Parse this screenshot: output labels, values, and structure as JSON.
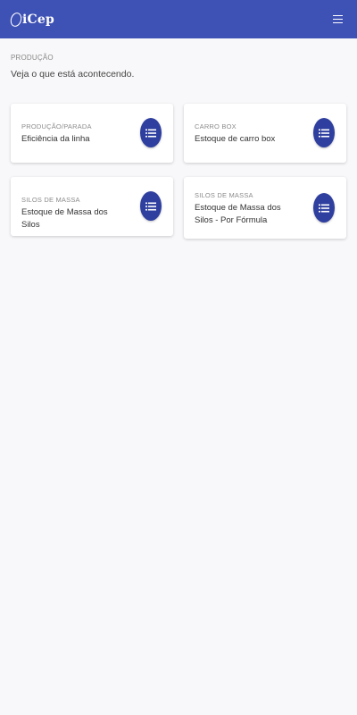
{
  "header": {
    "logo_text": "iCep",
    "menu_icon": "hamburger-menu-icon"
  },
  "main": {
    "section_label": "PRODUÇÃO",
    "subtitle": "Veja o que está acontecendo."
  },
  "cards": [
    {
      "kicker": "PRODUÇÃO/PARADA",
      "title": "Eficiência da linha",
      "icon": "list-icon"
    },
    {
      "kicker": "CARRO BOX",
      "title": "Estoque de carro box",
      "icon": "list-icon"
    },
    {
      "kicker": "SILOS DE MASSA",
      "title": "Estoque de Massa dos Silos",
      "icon": "list-icon"
    },
    {
      "kicker": "SILOS DE MASSA",
      "title": "Estoque de Massa dos Silos - Por Fórmula",
      "icon": "list-icon"
    }
  ],
  "colors": {
    "header_bg": "#3e51b5",
    "icon_bg": "#2f3f9f",
    "page_bg": "#f8f8fa"
  }
}
